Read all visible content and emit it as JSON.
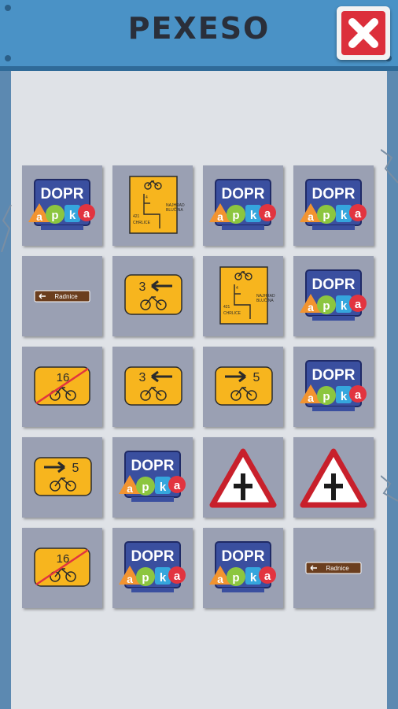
{
  "header": {
    "title": "PEXESO",
    "close_label": "close"
  },
  "colors": {
    "header_bg": "#4a92c6",
    "card_bg": "#9aa0b3",
    "close_red": "#dc2f3b",
    "sign_yellow": "#f7b51e",
    "dopr_blue": "#3a4f9f"
  },
  "board": {
    "rows": 5,
    "columns": 4,
    "cards": [
      {
        "type": "dopr-apka"
      },
      {
        "type": "route-map"
      },
      {
        "type": "dopr-apka"
      },
      {
        "type": "dopr-apka"
      },
      {
        "type": "radnice"
      },
      {
        "type": "arrow-left-3"
      },
      {
        "type": "route-map"
      },
      {
        "type": "dopr-apka"
      },
      {
        "type": "cancel-16"
      },
      {
        "type": "arrow-left-3"
      },
      {
        "type": "arrow-right-5"
      },
      {
        "type": "dopr-apka"
      },
      {
        "type": "arrow-right-5"
      },
      {
        "type": "dopr-apka"
      },
      {
        "type": "priority-crossroad"
      },
      {
        "type": "priority-crossroad"
      },
      {
        "type": "cancel-16"
      },
      {
        "type": "dopr-apka"
      },
      {
        "type": "dopr-apka"
      },
      {
        "type": "radnice"
      }
    ]
  },
  "texts": {
    "dopr": "DOPR",
    "apka_a": "a",
    "apka_p": "p",
    "apka_k": "k",
    "apka_a2": "a",
    "radnice": "Radnice",
    "num3": "3",
    "num5": "5",
    "num16": "16",
    "route_line1": "NAJHRAD",
    "route_line2": "BLUČINA",
    "route_line3": "CHRLICE",
    "route_num1": "4",
    "route_num2": "421"
  }
}
